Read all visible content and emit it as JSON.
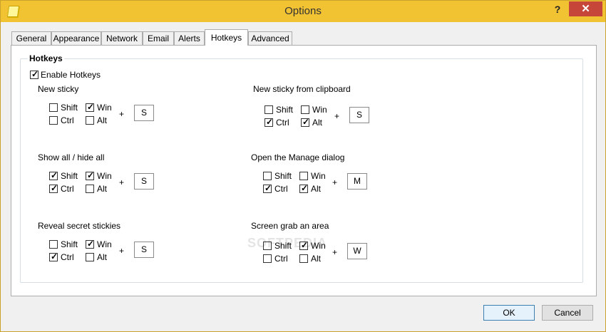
{
  "window": {
    "title": "Options",
    "help_glyph": "?",
    "close_glyph": "✕"
  },
  "tabs": [
    "General",
    "Appearance",
    "Network",
    "Email",
    "Alerts",
    "Hotkeys",
    "Advanced"
  ],
  "active_tab": "Hotkeys",
  "group": {
    "title": "Hotkeys"
  },
  "enable": {
    "label": "Enable Hotkeys",
    "checked": true
  },
  "modifier_labels": {
    "shift": "Shift",
    "win": "Win",
    "ctrl": "Ctrl",
    "alt": "Alt"
  },
  "plus": "+",
  "hotkeys": [
    {
      "title": "New sticky",
      "shift": false,
      "win": true,
      "ctrl": false,
      "alt": false,
      "key": "S"
    },
    {
      "title": "New sticky from clipboard",
      "shift": false,
      "win": false,
      "ctrl": true,
      "alt": true,
      "key": "S"
    },
    {
      "title": "Show all / hide all",
      "shift": true,
      "win": true,
      "ctrl": true,
      "alt": false,
      "key": "S"
    },
    {
      "title": "Open the Manage dialog",
      "shift": false,
      "win": false,
      "ctrl": true,
      "alt": true,
      "key": "M"
    },
    {
      "title": "Reveal secret stickies",
      "shift": false,
      "win": true,
      "ctrl": true,
      "alt": false,
      "key": "S"
    },
    {
      "title": "Screen grab an area",
      "shift": false,
      "win": true,
      "ctrl": false,
      "alt": false,
      "key": "W"
    }
  ],
  "buttons": {
    "ok": "OK",
    "cancel": "Cancel"
  },
  "watermark": "SOFTPEDIA"
}
